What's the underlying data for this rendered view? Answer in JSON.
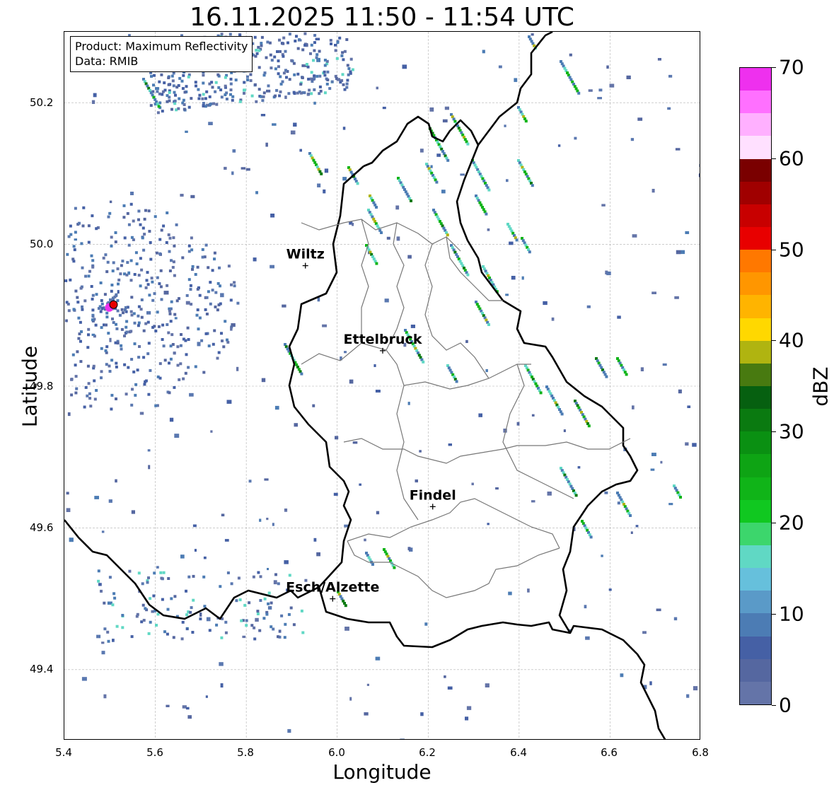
{
  "title": "16.11.2025 11:50 - 11:54 UTC",
  "info": {
    "product": "Product: Maximum Reflectivity",
    "data": "Data: RMIB"
  },
  "axes": {
    "xlabel": "Longitude",
    "ylabel": "Latitude",
    "xticks": [
      "5.4",
      "5.6",
      "5.8",
      "6.0",
      "6.2",
      "6.4",
      "6.6",
      "6.8"
    ],
    "yticks": [
      "50.2",
      "50.0",
      "49.8",
      "49.6",
      "49.4"
    ],
    "xlim": [
      5.4,
      6.8
    ],
    "ylim": [
      49.3,
      50.3
    ],
    "grid": true
  },
  "colorbar": {
    "label": "dBZ",
    "ticks": [
      "0",
      "10",
      "20",
      "30",
      "40",
      "50",
      "60",
      "70"
    ],
    "range": [
      0,
      70
    ],
    "colors": [
      "#6474a8",
      "#5567a0",
      "#4560a5",
      "#4c7cb4",
      "#5a9ac8",
      "#66c0dc",
      "#60d8c4",
      "#3cd66c",
      "#10c820",
      "#10b418",
      "#0ea414",
      "#0a9012",
      "#0a7a10",
      "#066010",
      "#487a10",
      "#b0b410",
      "#ffd800",
      "#ffb400",
      "#ff9600",
      "#ff7800",
      "#e80000",
      "#c80000",
      "#a00000",
      "#7a0000",
      "#ffe0ff",
      "#ffb0ff",
      "#ff70ff",
      "#ee30ee"
    ]
  },
  "cities": [
    {
      "name": "Wiltz",
      "lon": 5.93,
      "lat": 49.97
    },
    {
      "name": "Ettelbruck",
      "lon": 6.1,
      "lat": 49.85
    },
    {
      "name": "Findel",
      "lon": 6.21,
      "lat": 49.63
    },
    {
      "name": "Esch/Alzette",
      "lon": 5.99,
      "lat": 49.5
    }
  ],
  "radar_site": {
    "lon": 5.505,
    "lat": 49.915
  }
}
